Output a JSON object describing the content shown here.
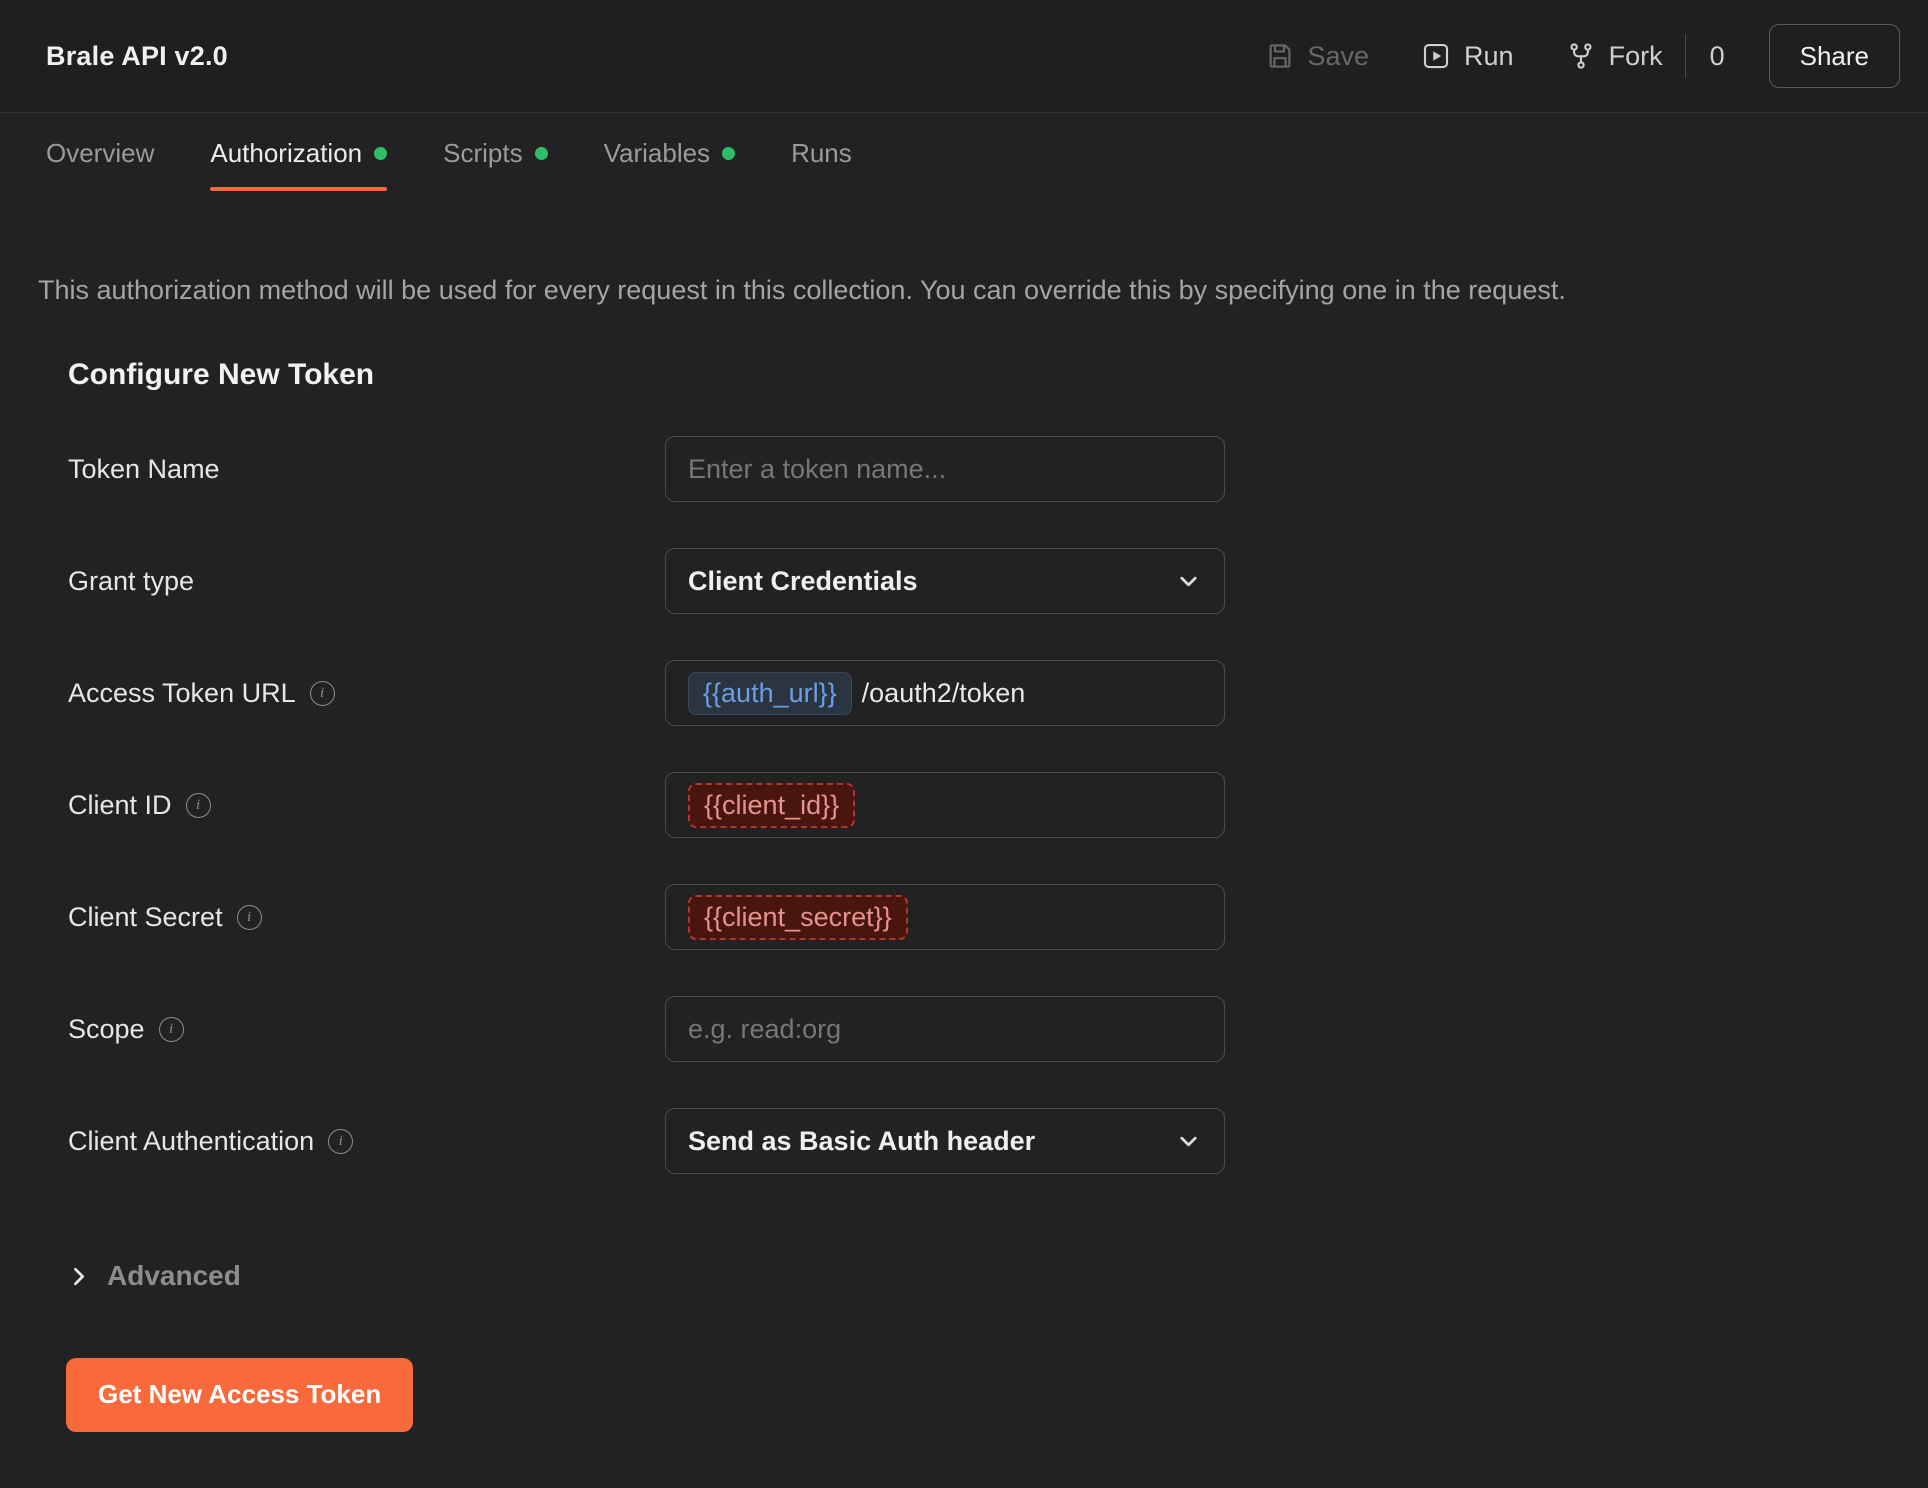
{
  "header": {
    "title": "Brale API v2.0",
    "save_label": "Save",
    "run_label": "Run",
    "fork_label": "Fork",
    "fork_count": "0",
    "share_label": "Share"
  },
  "tabs": [
    {
      "label": "Overview",
      "active": false,
      "status_dot": false
    },
    {
      "label": "Authorization",
      "active": true,
      "status_dot": true
    },
    {
      "label": "Scripts",
      "active": false,
      "status_dot": true
    },
    {
      "label": "Variables",
      "active": false,
      "status_dot": true
    },
    {
      "label": "Runs",
      "active": false,
      "status_dot": false
    }
  ],
  "banner": "This authorization method will be used for every request in this collection. You can override this by specifying one in the request.",
  "section_title": "Configure New Token",
  "form": {
    "token_name": {
      "label": "Token Name",
      "placeholder": "Enter a token name..."
    },
    "grant_type": {
      "label": "Grant type",
      "value": "Client Credentials"
    },
    "access_token_url": {
      "label": "Access Token URL",
      "variable": "{{auth_url}}",
      "path_suffix": "/oauth2/token"
    },
    "client_id": {
      "label": "Client ID",
      "variable": "{{client_id}}"
    },
    "client_secret": {
      "label": "Client Secret",
      "variable": "{{client_secret}}"
    },
    "scope": {
      "label": "Scope",
      "placeholder": "e.g. read:org"
    },
    "client_authentication": {
      "label": "Client Authentication",
      "value": "Send as Basic Auth header"
    }
  },
  "advanced": {
    "label": "Advanced"
  },
  "actions": {
    "get_new_access_token": "Get New Access Token"
  },
  "icons": {
    "save": "floppy-disk",
    "run": "play-in-square",
    "fork": "fork-branch",
    "info": "circled-i",
    "select": "chevron-down",
    "advanced": "chevron-right"
  },
  "colors": {
    "accent_orange": "#f2693c",
    "button_orange": "#f8693b",
    "status_dot_green": "#2fbe68",
    "resolved_variable_text": "#6b9fe4",
    "resolved_variable_bg": "#2b3542",
    "unresolved_variable_text": "#e5938b",
    "unresolved_variable_bg": "#49150e",
    "unresolved_variable_border": "#a93a2c",
    "page_bg": "#222224",
    "topbar_bg": "#1f1f21",
    "input_border": "#4c4c4f"
  }
}
